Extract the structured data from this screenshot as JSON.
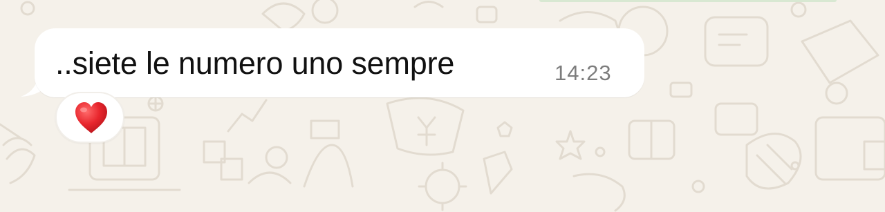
{
  "message": {
    "text": "..siete le numero uno sempre",
    "time": "14:23",
    "reaction": {
      "emoji": "❤️",
      "icon": "heart-icon",
      "color": "#e8262d"
    }
  },
  "colors": {
    "wallpaper": "#f5f1ea",
    "bubble": "#ffffff",
    "text": "#111111",
    "timestamp": "#7d7d7d"
  }
}
